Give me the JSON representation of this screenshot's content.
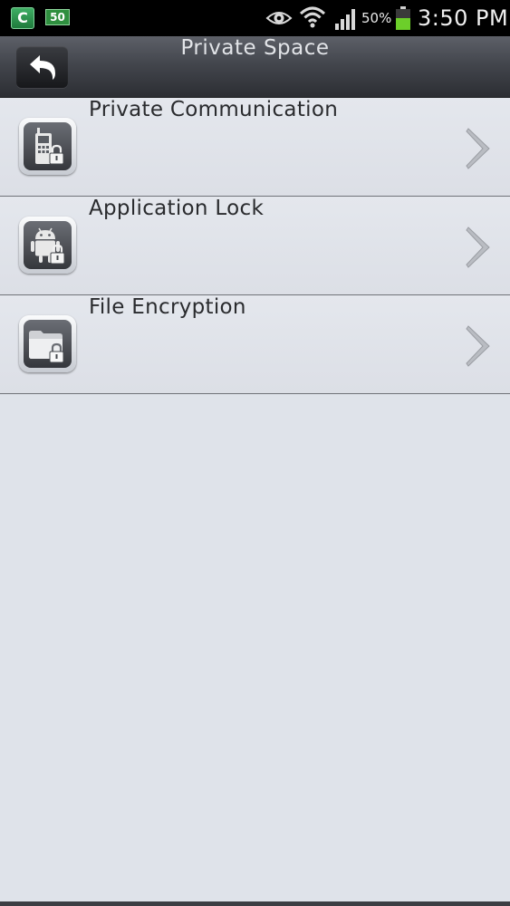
{
  "status_bar": {
    "app_icon_letter": "C",
    "badge_text": "50",
    "battery_percent": "50%",
    "time": "3:50 PM",
    "icons": [
      "app-notification-icon",
      "eye-icon",
      "wifi-icon",
      "signal-icon",
      "battery-icon"
    ]
  },
  "header": {
    "title": "Private Space",
    "back_icon": "back-arrow-icon"
  },
  "menu": {
    "items": [
      {
        "label": "Private Communication",
        "icon": "phone-lock-icon"
      },
      {
        "label": "Application Lock",
        "icon": "android-lock-icon"
      },
      {
        "label": "File Encryption",
        "icon": "folder-lock-icon"
      }
    ],
    "chevron_icon": "chevron-right-icon"
  },
  "colors": {
    "status_bar_bg": "#000000",
    "header_bg": "#43464d",
    "list_bg": "#dfe3ea",
    "divider": "#6f7278",
    "label_text": "#2a2b2e",
    "battery_green": "#6ccf2a"
  }
}
